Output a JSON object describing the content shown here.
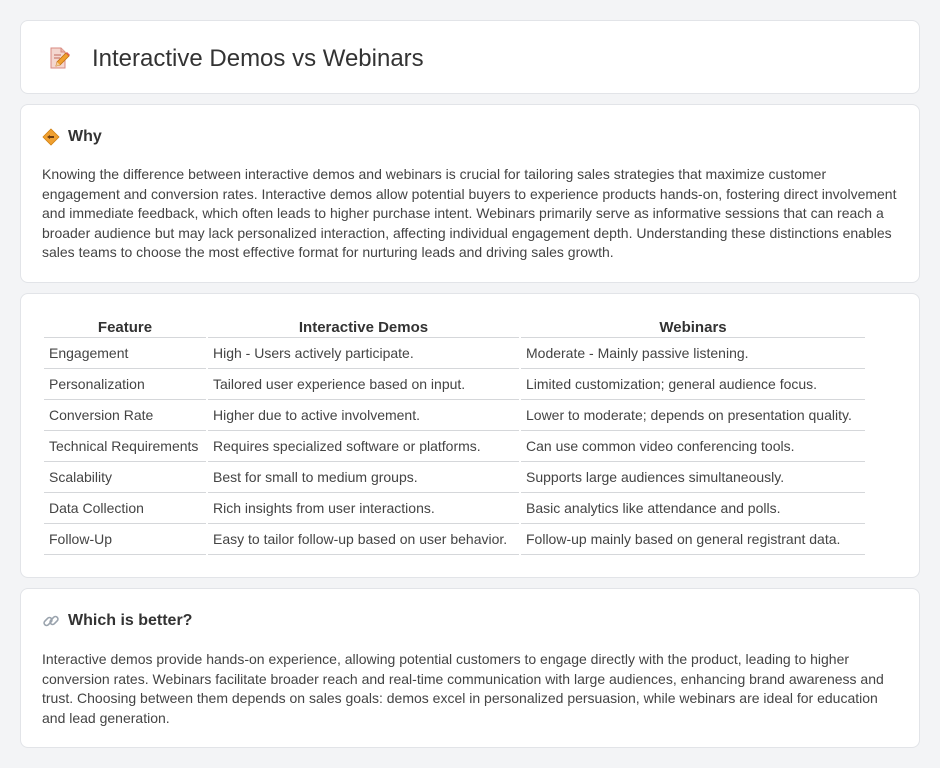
{
  "header": {
    "title": "Interactive Demos vs Webinars",
    "icon": "pencil-document-icon"
  },
  "why": {
    "icon": "diamond-warning-icon",
    "title": "Why",
    "text": "Knowing the difference between interactive demos and webinars is crucial for tailoring sales strategies that maximize customer engagement and conversion rates. Interactive demos allow potential buyers to experience products hands-on, fostering direct involvement and immediate feedback, which often leads to higher purchase intent. Webinars primarily serve as informative sessions that can reach a broader audience but may lack personalized interaction, affecting individual engagement depth. Understanding these distinctions enables sales teams to choose the most effective format for nurturing leads and driving sales growth."
  },
  "comparison": {
    "columns": [
      "Feature",
      "Interactive Demos",
      "Webinars"
    ],
    "rows": [
      [
        "Engagement",
        "High - Users actively participate.",
        "Moderate - Mainly passive listening."
      ],
      [
        "Personalization",
        "Tailored user experience based on input.",
        "Limited customization; general audience focus."
      ],
      [
        "Conversion Rate",
        "Higher due to active involvement.",
        "Lower to moderate; depends on presentation quality."
      ],
      [
        "Technical Requirements",
        "Requires specialized software or platforms.",
        "Can use common video conferencing tools."
      ],
      [
        "Scalability",
        "Best for small to medium groups.",
        "Supports large audiences simultaneously."
      ],
      [
        "Data Collection",
        "Rich insights from user interactions.",
        "Basic analytics like attendance and polls."
      ],
      [
        "Follow-Up",
        "Easy to tailor follow-up based on user behavior.",
        "Follow-up mainly based on general registrant data."
      ]
    ]
  },
  "better": {
    "icon": "link-icon",
    "title": "Which is better?",
    "text": "Interactive demos provide hands-on experience, allowing potential customers to engage directly with the product, leading to higher conversion rates. Webinars facilitate broader reach and real-time communication with large audiences, enhancing brand awareness and trust. Choosing between them depends on sales goals: demos excel in personalized persuasion, while webinars are ideal for education and lead generation."
  },
  "colors": {
    "background": "#f3f4f6",
    "card": "#ffffff",
    "border": "#e2e4e8",
    "icon_orange": "#f0a030",
    "icon_pink": "#e88080"
  }
}
